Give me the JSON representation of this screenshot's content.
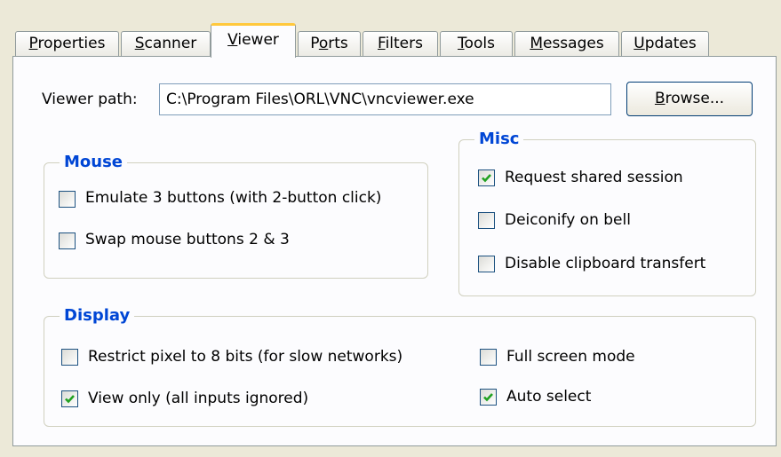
{
  "tabs": [
    {
      "pre": "",
      "mn": "P",
      "post": "roperties"
    },
    {
      "pre": "",
      "mn": "S",
      "post": "canner"
    },
    {
      "pre": "",
      "mn": "V",
      "post": "iewer"
    },
    {
      "pre": "P",
      "mn": "o",
      "post": "rts"
    },
    {
      "pre": "",
      "mn": "F",
      "post": "ilters"
    },
    {
      "pre": "",
      "mn": "T",
      "post": "ools"
    },
    {
      "pre": "",
      "mn": "M",
      "post": "essages"
    },
    {
      "pre": "",
      "mn": "U",
      "post": "pdates"
    }
  ],
  "active_tab": "Viewer",
  "viewer_path": {
    "label": "Viewer path:",
    "value": "C:\\Program Files\\ORL\\VNC\\vncviewer.exe",
    "browse": {
      "mn": "B",
      "post": "rowse..."
    }
  },
  "mouse": {
    "title": "Mouse",
    "emulate3": {
      "label": "Emulate 3 buttons (with 2-button click)",
      "checked": false
    },
    "swap": {
      "label": "Swap mouse buttons 2 & 3",
      "checked": false
    }
  },
  "misc": {
    "title": "Misc",
    "shared": {
      "label": "Request shared session",
      "checked": true
    },
    "deiconify": {
      "label": "Deiconify on bell",
      "checked": false
    },
    "clipboard": {
      "label": "Disable clipboard transfert",
      "checked": false
    }
  },
  "display": {
    "title": "Display",
    "restrict": {
      "label": "Restrict pixel to 8 bits (for slow networks)",
      "checked": false
    },
    "viewonly": {
      "label": "View only (all inputs ignored)",
      "checked": true
    },
    "fullscreen": {
      "label": "Full screen mode",
      "checked": false
    },
    "autoselect": {
      "label": "Auto select",
      "checked": true
    }
  },
  "colors": {
    "accent": "#0046d5",
    "tab_highlight": "#ffc83c",
    "check": "#21a121"
  }
}
